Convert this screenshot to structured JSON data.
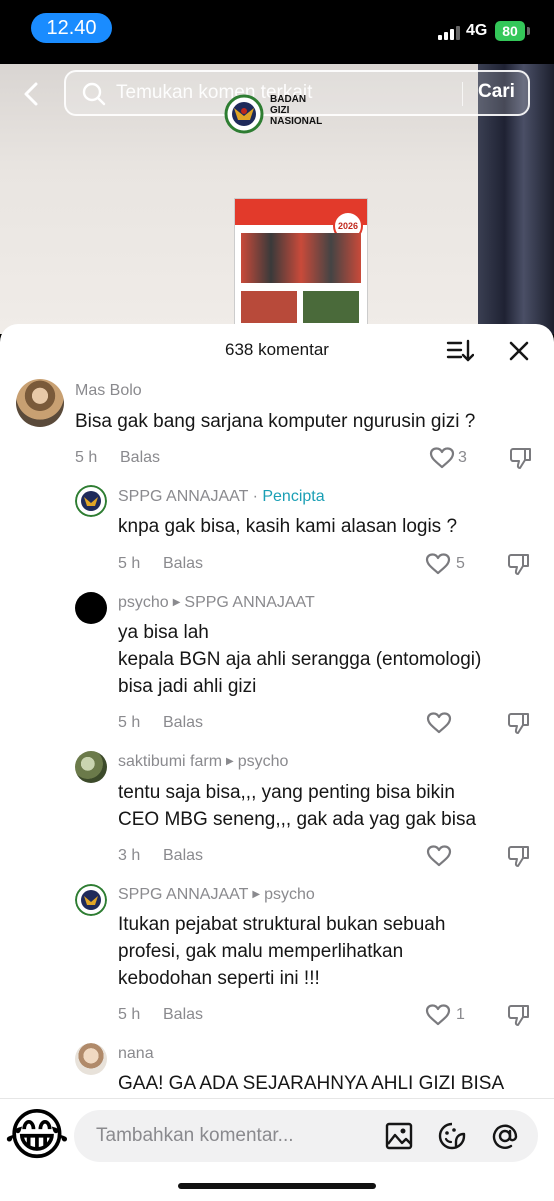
{
  "status_bar": {
    "time": "12.40",
    "network": "4G",
    "battery": "80"
  },
  "video": {
    "search_placeholder": "Temukan komen terkait",
    "search_button": "Cari",
    "logo_text": [
      "BADAN",
      "GIZI",
      "NASIONAL"
    ],
    "poster_year": "2026"
  },
  "sheet": {
    "title": "638 komentar"
  },
  "comments": [
    {
      "name": "Mas Bolo",
      "text": "Bisa gak bang sarjana komputer ngurusin gizi ?",
      "time": "5 h",
      "reply": "Balas",
      "likes": "3"
    },
    {
      "name": "SPPG ANNAJAAT",
      "sep": " · ",
      "tag": "Pencipta",
      "text": "knpa gak bisa, kasih kami alasan logis ?",
      "time": "5 h",
      "reply": "Balas",
      "likes": "5"
    },
    {
      "name": "psycho",
      "reply_to": "SPPG ANNAJAAT",
      "text": "ya bisa lah\nkepala BGN aja ahli serangga (entomologi)\nbisa jadi ahli gizi",
      "time": "5 h",
      "reply": "Balas",
      "likes": ""
    },
    {
      "name": "saktibumi farm",
      "reply_to": "psycho",
      "text": "tentu saja bisa,,, yang penting bisa bikin\nCEO MBG seneng,,, gak ada yag gak bisa",
      "time": "3 h",
      "reply": "Balas",
      "likes": ""
    },
    {
      "name": "SPPG ANNAJAAT",
      "reply_to": "psycho",
      "text": "Itukan pejabat struktural bukan sebuah\nprofesi, gak malu memperlihatkan\nkebodohan seperti ini !!!",
      "time": "5 h",
      "reply": "Balas",
      "likes": "1"
    },
    {
      "name": "nana",
      "text": "GAA! GA ADA SEJARAHNYA AHLI GIZI BISA"
    }
  ],
  "composer": {
    "placeholder": "Tambahkan komentar...",
    "emoji": "😂"
  },
  "colors": {
    "accent_blue": "#1a8cff",
    "creator_tag": "#1a9fb5",
    "battery_green": "#34c759"
  }
}
